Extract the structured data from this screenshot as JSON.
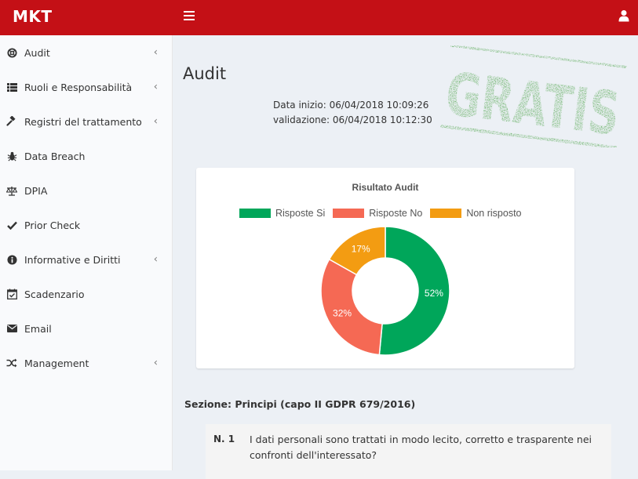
{
  "app": {
    "logo": "MKT"
  },
  "header": {
    "menu_icon": "hamburger-icon",
    "user_icon": "user-icon"
  },
  "sidebar": {
    "items": [
      {
        "label": "Audit",
        "icon": "life-ring-icon",
        "has_submenu": true
      },
      {
        "label": "Ruoli e Responsabilità",
        "icon": "list-icon",
        "has_submenu": true
      },
      {
        "label": "Registri del trattamento",
        "icon": "gavel-icon",
        "has_submenu": true
      },
      {
        "label": "Data Breach",
        "icon": "bug-icon",
        "has_submenu": false
      },
      {
        "label": "DPIA",
        "icon": "balance-scale-icon",
        "has_submenu": false
      },
      {
        "label": "Prior Check",
        "icon": "check-icon",
        "has_submenu": false
      },
      {
        "label": "Informative e Diritti",
        "icon": "info-circle-icon",
        "has_submenu": true
      },
      {
        "label": "Scadenzario",
        "icon": "calendar-check-icon",
        "has_submenu": false
      },
      {
        "label": "Email",
        "icon": "envelope-icon",
        "has_submenu": false
      },
      {
        "label": "Management",
        "icon": "random-icon",
        "has_submenu": true
      }
    ]
  },
  "page": {
    "title": "Audit",
    "start_date_line": "Data inizio: 06/04/2018 10:09:26",
    "validation_line": "validazione: 06/04/2018 10:12:30",
    "stamp": "GRATIS"
  },
  "chart_data": {
    "type": "pie",
    "title": "Risultato Audit",
    "categories": [
      "Risposte Si",
      "Risposte No",
      "Non risposto"
    ],
    "values": [
      52,
      32,
      17
    ],
    "labels": [
      "52%",
      "32%",
      "17%"
    ],
    "colors": [
      "#00a65a",
      "#f56954",
      "#f39c12"
    ],
    "legend": "top"
  },
  "section": {
    "title": "Sezione: Principi (capo II GDPR 679/2016)",
    "question_number": "N. 1",
    "question_text": "I dati personali sono trattati in modo lecito, corretto e trasparente nei confronti dell'interessato?"
  }
}
